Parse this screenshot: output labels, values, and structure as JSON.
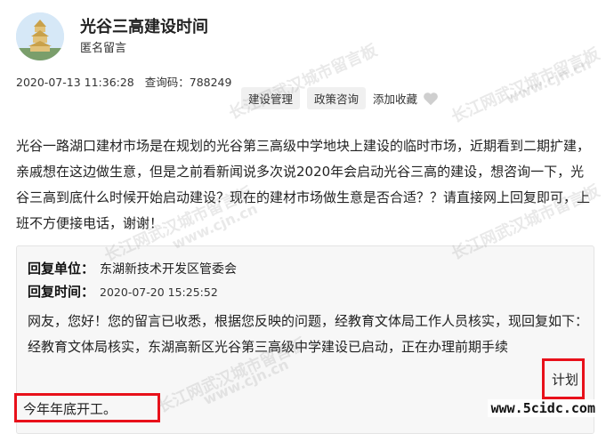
{
  "post": {
    "title": "光谷三高建设时间",
    "author": "匿名留言",
    "date": "2020-07-13 11:36:28",
    "query_code_label": "查询码：788249",
    "tags": [
      "建设管理",
      "政策咨询"
    ],
    "favorite_label": "添加收藏",
    "body": "光谷一路湖口建材市场是在规划的光谷第三高级中学地块上建设的临时市场，近期看到二期扩建，亲戚想在这边做生意，但是之前看新闻说多次说2020年会启动光谷三高的建设，想咨询一下，光谷三高到底什么时候开始启动建设？现在的建材市场做生意是否合适？？请直接网上回复即可，上班不方便接电话，谢谢！"
  },
  "reply": {
    "unit_label": "回复单位：",
    "unit": "东湖新技术开发区管委会",
    "time_label": "回复时间：",
    "time": "2020-07-20 15:25:52",
    "text_1": "网友，您好！您的留言已收悉，根据您反映的问题，经教育文体局工作人员核实，现回复如下：",
    "text_2": "经教育文体局核实，东湖高新区光谷第三高级中学建设已启动，正在办理前期手续",
    "text_2_highlight": "计划",
    "text_3_highlight": "今年年底开工。"
  },
  "watermark": {
    "line": "长江网武汉城市留言板",
    "url": "www.cjn.cn"
  },
  "site_stamp": "www.5cidc.com",
  "colors": {
    "highlight": "#e8101a",
    "tag_bg": "#f0f0f0",
    "reply_bg": "#f7f7f7"
  },
  "icons": {
    "avatar": "pagoda-tower-avatar",
    "favorite": "heart-icon"
  }
}
